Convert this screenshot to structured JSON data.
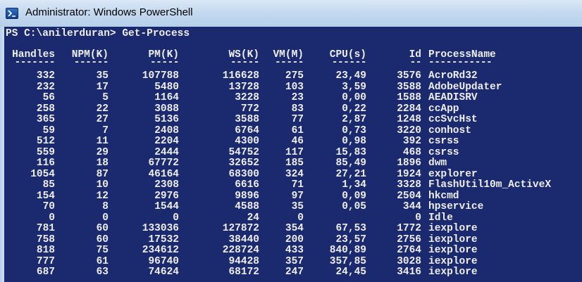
{
  "window": {
    "title": "Administrator: Windows PowerShell",
    "icon": "powershell-icon"
  },
  "console": {
    "prompt": "PS C:\\anilerduran> Get-Process",
    "headers": [
      "Handles",
      "NPM(K)",
      "PM(K)",
      "WS(K)",
      "VM(M)",
      "CPU(s)",
      "Id",
      "ProcessName"
    ],
    "underlines": [
      "-------",
      "------",
      "-----",
      "-----",
      "-----",
      "------",
      "--",
      "-----------"
    ],
    "rows": [
      [
        "332",
        "35",
        "107788",
        "116628",
        "275",
        "23,49",
        "3576",
        "AcroRd32"
      ],
      [
        "232",
        "17",
        "5480",
        "13728",
        "103",
        "3,59",
        "3588",
        "AdobeUpdater"
      ],
      [
        "56",
        "5",
        "1164",
        "3228",
        "23",
        "0,00",
        "1588",
        "AEADISRV"
      ],
      [
        "258",
        "22",
        "3088",
        "772",
        "83",
        "0,22",
        "2284",
        "ccApp"
      ],
      [
        "365",
        "27",
        "5136",
        "3588",
        "77",
        "2,87",
        "1248",
        "ccSvcHst"
      ],
      [
        "59",
        "7",
        "2408",
        "6764",
        "61",
        "0,73",
        "3220",
        "conhost"
      ],
      [
        "512",
        "11",
        "2204",
        "4300",
        "46",
        "0,98",
        "392",
        "csrss"
      ],
      [
        "559",
        "29",
        "2444",
        "54752",
        "117",
        "15,83",
        "468",
        "csrss"
      ],
      [
        "116",
        "18",
        "67772",
        "32652",
        "185",
        "85,49",
        "1896",
        "dwm"
      ],
      [
        "1054",
        "87",
        "46164",
        "68300",
        "324",
        "27,21",
        "1924",
        "explorer"
      ],
      [
        "85",
        "10",
        "2308",
        "6616",
        "71",
        "1,34",
        "3328",
        "FlashUtil10m_ActiveX"
      ],
      [
        "154",
        "12",
        "2976",
        "9896",
        "97",
        "0,09",
        "2504",
        "hkcmd"
      ],
      [
        "70",
        "8",
        "1544",
        "4588",
        "35",
        "0,05",
        "344",
        "hpservice"
      ],
      [
        "0",
        "0",
        "0",
        "24",
        "0",
        "",
        "0",
        "Idle"
      ],
      [
        "781",
        "60",
        "133036",
        "127872",
        "354",
        "67,53",
        "1772",
        "iexplore"
      ],
      [
        "758",
        "60",
        "17532",
        "38440",
        "200",
        "23,57",
        "2756",
        "iexplore"
      ],
      [
        "818",
        "75",
        "234612",
        "228724",
        "433",
        "840,89",
        "2764",
        "iexplore"
      ],
      [
        "777",
        "61",
        "96740",
        "94428",
        "357",
        "357,85",
        "3028",
        "iexplore"
      ],
      [
        "687",
        "63",
        "74624",
        "68172",
        "247",
        "24,45",
        "3416",
        "iexplore"
      ]
    ]
  }
}
